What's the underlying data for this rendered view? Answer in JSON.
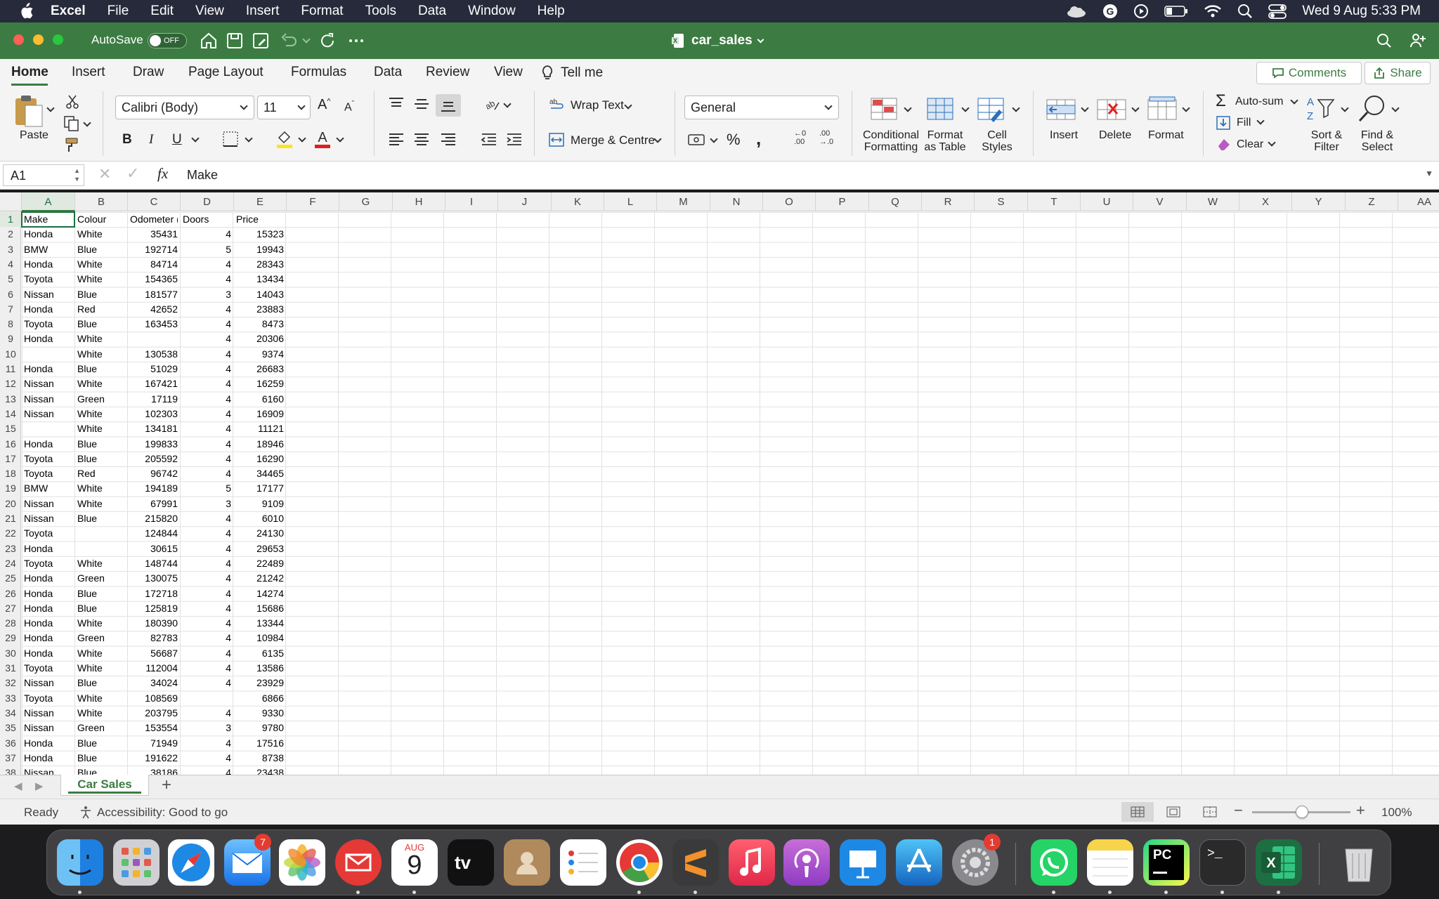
{
  "menubar": {
    "app": "Excel",
    "items": [
      "File",
      "Edit",
      "View",
      "Insert",
      "Format",
      "Tools",
      "Data",
      "Window",
      "Help"
    ],
    "datetime": "Wed 9 Aug  5:33 PM"
  },
  "window": {
    "autosave_label": "AutoSave",
    "autosave_state": "OFF",
    "doc_title": "car_sales"
  },
  "tabs": [
    "Home",
    "Insert",
    "Draw",
    "Page Layout",
    "Formulas",
    "Data",
    "Review",
    "View"
  ],
  "tell_me": "Tell me",
  "comments": "Comments",
  "share": "Share",
  "ribbon": {
    "paste": "Paste",
    "font_name": "Calibri (Body)",
    "font_size": "11",
    "wrap_text": "Wrap Text",
    "merge": "Merge & Centre",
    "number_format": "General",
    "cond_fmt": [
      "Conditional",
      "Formatting"
    ],
    "fmt_table": [
      "Format",
      "as Table"
    ],
    "cell_styles": [
      "Cell",
      "Styles"
    ],
    "insert": "Insert",
    "delete": "Delete",
    "format": "Format",
    "autosum": "Auto-sum",
    "fill": "Fill",
    "clear": "Clear",
    "sort": [
      "Sort &",
      "Filter"
    ],
    "find": [
      "Find &",
      "Select"
    ]
  },
  "formula_bar": {
    "name_box": "A1",
    "fx": "fx",
    "value": "Make"
  },
  "columns": [
    "A",
    "B",
    "C",
    "D",
    "E",
    "F",
    "G",
    "H",
    "I",
    "J",
    "K",
    "L",
    "M",
    "N",
    "O",
    "P",
    "Q",
    "R",
    "S",
    "T",
    "U",
    "V",
    "W",
    "X",
    "Y",
    "Z",
    "AA"
  ],
  "rows": [
    [
      "Make",
      "Colour",
      "Odometer (",
      "Doors",
      "Price"
    ],
    [
      "Honda",
      "White",
      "35431",
      "4",
      "15323"
    ],
    [
      "BMW",
      "Blue",
      "192714",
      "5",
      "19943"
    ],
    [
      "Honda",
      "White",
      "84714",
      "4",
      "28343"
    ],
    [
      "Toyota",
      "White",
      "154365",
      "4",
      "13434"
    ],
    [
      "Nissan",
      "Blue",
      "181577",
      "3",
      "14043"
    ],
    [
      "Honda",
      "Red",
      "42652",
      "4",
      "23883"
    ],
    [
      "Toyota",
      "Blue",
      "163453",
      "4",
      "8473"
    ],
    [
      "Honda",
      "White",
      "",
      "4",
      "20306"
    ],
    [
      "",
      "White",
      "130538",
      "4",
      "9374"
    ],
    [
      "Honda",
      "Blue",
      "51029",
      "4",
      "26683"
    ],
    [
      "Nissan",
      "White",
      "167421",
      "4",
      "16259"
    ],
    [
      "Nissan",
      "Green",
      "17119",
      "4",
      "6160"
    ],
    [
      "Nissan",
      "White",
      "102303",
      "4",
      "16909"
    ],
    [
      "",
      "White",
      "134181",
      "4",
      "11121"
    ],
    [
      "Honda",
      "Blue",
      "199833",
      "4",
      "18946"
    ],
    [
      "Toyota",
      "Blue",
      "205592",
      "4",
      "16290"
    ],
    [
      "Toyota",
      "Red",
      "96742",
      "4",
      "34465"
    ],
    [
      "BMW",
      "White",
      "194189",
      "5",
      "17177"
    ],
    [
      "Nissan",
      "White",
      "67991",
      "3",
      "9109"
    ],
    [
      "Nissan",
      "Blue",
      "215820",
      "4",
      "6010"
    ],
    [
      "Toyota",
      "",
      "124844",
      "4",
      "24130"
    ],
    [
      "Honda",
      "",
      "30615",
      "4",
      "29653"
    ],
    [
      "Toyota",
      "White",
      "148744",
      "4",
      "22489"
    ],
    [
      "Honda",
      "Green",
      "130075",
      "4",
      "21242"
    ],
    [
      "Honda",
      "Blue",
      "172718",
      "4",
      "14274"
    ],
    [
      "Honda",
      "Blue",
      "125819",
      "4",
      "15686"
    ],
    [
      "Honda",
      "White",
      "180390",
      "4",
      "13344"
    ],
    [
      "Honda",
      "Green",
      "82783",
      "4",
      "10984"
    ],
    [
      "Honda",
      "White",
      "56687",
      "4",
      "6135"
    ],
    [
      "Toyota",
      "White",
      "112004",
      "4",
      "13586"
    ],
    [
      "Nissan",
      "Blue",
      "34024",
      "4",
      "23929"
    ],
    [
      "Toyota",
      "White",
      "108569",
      "",
      "6866"
    ],
    [
      "Nissan",
      "White",
      "203795",
      "4",
      "9330"
    ],
    [
      "Nissan",
      "Green",
      "153554",
      "3",
      "9780"
    ],
    [
      "Honda",
      "Blue",
      "71949",
      "4",
      "17516"
    ],
    [
      "Honda",
      "Blue",
      "191622",
      "4",
      "8738"
    ],
    [
      "Nissan",
      "Blue",
      "38186",
      "4",
      "23438"
    ]
  ],
  "sheet_tab": "Car Sales",
  "status": {
    "ready": "Ready",
    "accessibility": "Accessibility: Good to go",
    "zoom": "100%"
  },
  "dock": {
    "mail_badge": "7",
    "settings_badge": "1",
    "calendar_month": "AUG",
    "calendar_day": "9"
  }
}
